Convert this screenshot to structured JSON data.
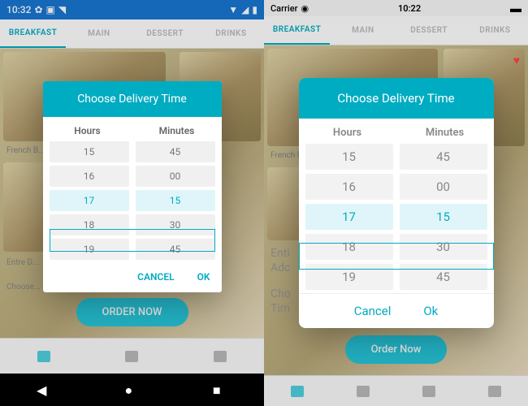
{
  "android": {
    "status_time": "10:32",
    "tabs": [
      "BREAKFAST",
      "MAIN",
      "DESSERT",
      "DRINKS"
    ],
    "labels": {
      "french": "French B...",
      "entre": "Entre D...",
      "choose": "Choose..."
    },
    "order_btn": "ORDER NOW",
    "dialog": {
      "title": "Choose Delivery Time",
      "hours_label": "Hours",
      "minutes_label": "Minutes",
      "hours": [
        "15",
        "16",
        "17",
        "18",
        "19"
      ],
      "minutes": [
        "45",
        "00",
        "15",
        "30",
        "45"
      ],
      "cancel": "CANCEL",
      "ok": "OK"
    }
  },
  "ios": {
    "carrier": "Carrier",
    "status_time": "10:22",
    "tabs": [
      "BREAKFAST",
      "MAIN",
      "DESSERT",
      "DRINKS"
    ],
    "labels": {
      "french": "French B",
      "entre_line1": "Enti",
      "entre_line2": "Adc",
      "choose_line1": "Cho",
      "choose_line2": "Tim"
    },
    "order_btn": "Order Now",
    "dialog": {
      "title": "Choose Delivery Time",
      "hours_label": "Hours",
      "minutes_label": "Minutes",
      "hours": [
        "15",
        "16",
        "17",
        "18",
        "19"
      ],
      "minutes": [
        "45",
        "00",
        "15",
        "30",
        "45"
      ],
      "cancel": "Cancel",
      "ok": "Ok"
    }
  }
}
